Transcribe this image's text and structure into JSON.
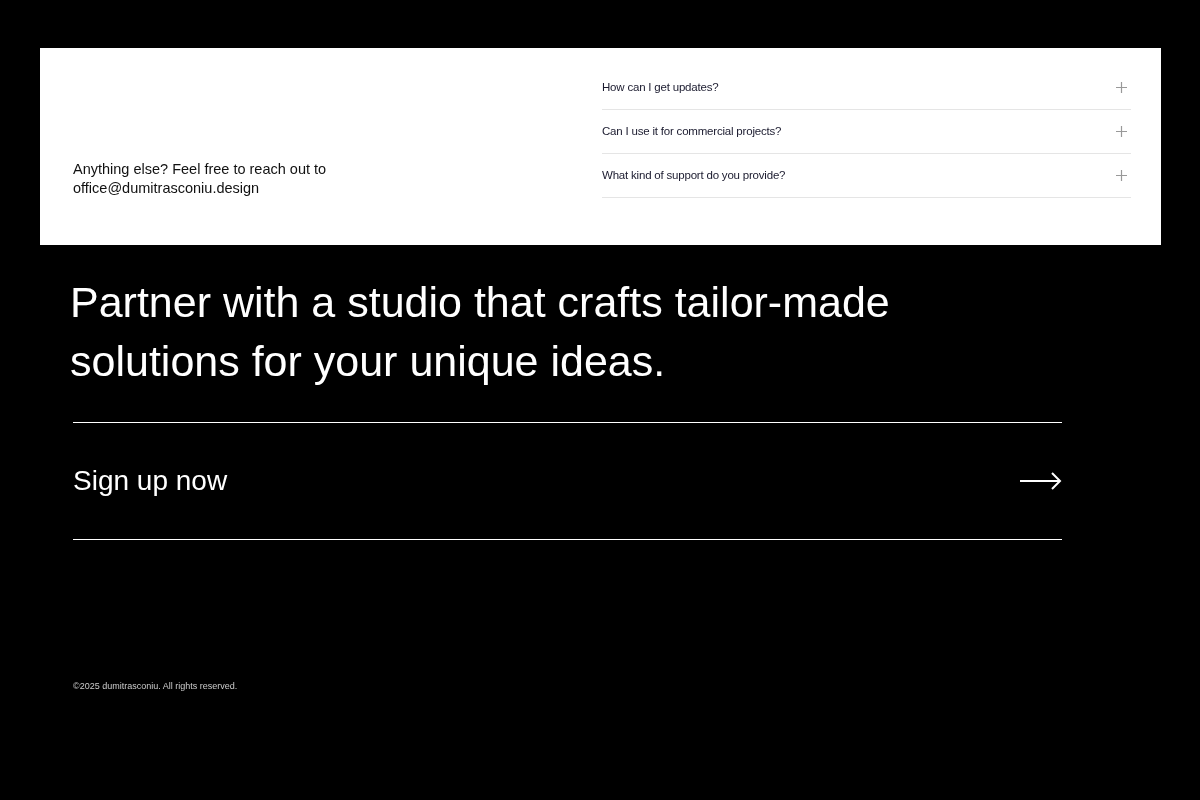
{
  "contact": {
    "text": "Anything else? Feel free to reach out to",
    "email": "office@dumitrasconiu.design"
  },
  "faq": [
    {
      "question": "How can I get updates?",
      "expanded": false
    },
    {
      "question": "Can I use it for commercial projects?",
      "expanded": false
    },
    {
      "question": "What kind of support do you provide?",
      "expanded": false
    }
  ],
  "headline": "Partner with a studio that crafts tailor-made solutions for your unique ideas.",
  "cta": {
    "label": "Sign up now"
  },
  "footer": {
    "copyright": "©2025 dumitrasconiu. All rights reserved."
  }
}
